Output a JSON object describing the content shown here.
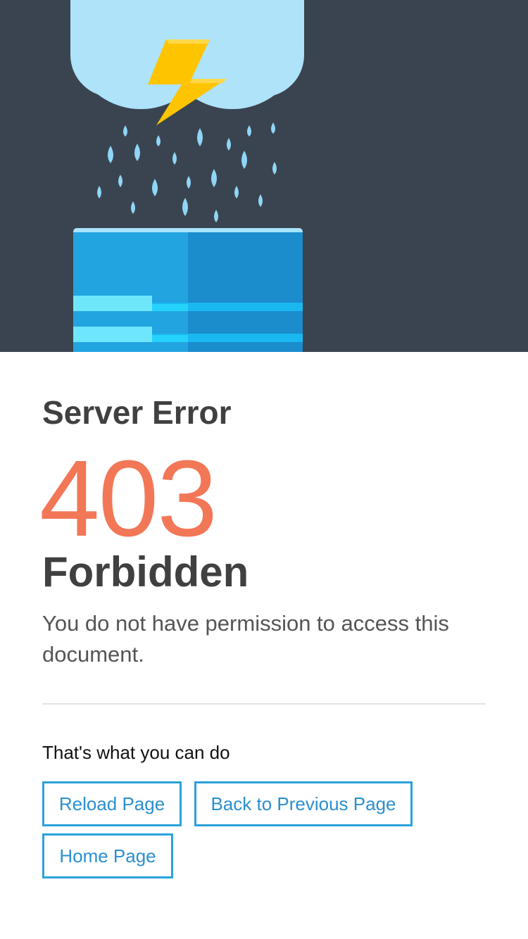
{
  "colors": {
    "hero_background": "#3a4450",
    "error_code": "#f27757",
    "button_border": "#2aa2dc",
    "button_text": "#2b8fd0",
    "cloud": "#aee3fa",
    "lightning": "#ffc400",
    "raindrop": "#8fd6f6",
    "server": "#1e90d0"
  },
  "illustration": {
    "icons": [
      "cloud-icon",
      "lightning-bolt-icon",
      "raindrops-icon",
      "server-icon"
    ]
  },
  "error": {
    "heading": "Server Error",
    "code": "403",
    "title": "Forbidden",
    "message": "You do not have permission to access this document."
  },
  "actions": {
    "heading": "That's what you can do",
    "reload_label": "Reload Page",
    "back_label": "Back to Previous Page",
    "home_label": "Home Page"
  }
}
